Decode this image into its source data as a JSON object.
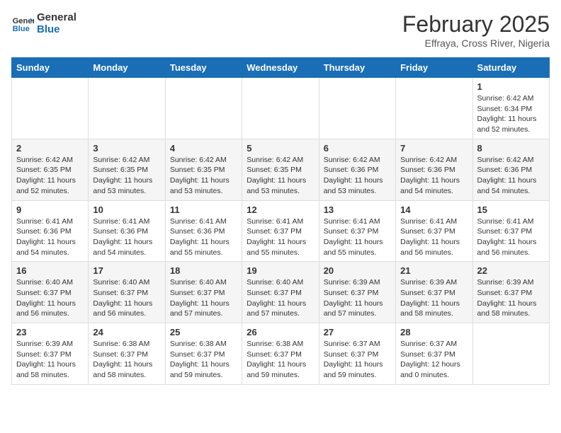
{
  "header": {
    "logo_line1": "General",
    "logo_line2": "Blue",
    "month_title": "February 2025",
    "location": "Effraya, Cross River, Nigeria"
  },
  "weekdays": [
    "Sunday",
    "Monday",
    "Tuesday",
    "Wednesday",
    "Thursday",
    "Friday",
    "Saturday"
  ],
  "weeks": [
    [
      {
        "day": "",
        "info": ""
      },
      {
        "day": "",
        "info": ""
      },
      {
        "day": "",
        "info": ""
      },
      {
        "day": "",
        "info": ""
      },
      {
        "day": "",
        "info": ""
      },
      {
        "day": "",
        "info": ""
      },
      {
        "day": "1",
        "info": "Sunrise: 6:42 AM\nSunset: 6:34 PM\nDaylight: 11 hours\nand 52 minutes."
      }
    ],
    [
      {
        "day": "2",
        "info": "Sunrise: 6:42 AM\nSunset: 6:35 PM\nDaylight: 11 hours\nand 52 minutes."
      },
      {
        "day": "3",
        "info": "Sunrise: 6:42 AM\nSunset: 6:35 PM\nDaylight: 11 hours\nand 53 minutes."
      },
      {
        "day": "4",
        "info": "Sunrise: 6:42 AM\nSunset: 6:35 PM\nDaylight: 11 hours\nand 53 minutes."
      },
      {
        "day": "5",
        "info": "Sunrise: 6:42 AM\nSunset: 6:35 PM\nDaylight: 11 hours\nand 53 minutes."
      },
      {
        "day": "6",
        "info": "Sunrise: 6:42 AM\nSunset: 6:36 PM\nDaylight: 11 hours\nand 53 minutes."
      },
      {
        "day": "7",
        "info": "Sunrise: 6:42 AM\nSunset: 6:36 PM\nDaylight: 11 hours\nand 54 minutes."
      },
      {
        "day": "8",
        "info": "Sunrise: 6:42 AM\nSunset: 6:36 PM\nDaylight: 11 hours\nand 54 minutes."
      }
    ],
    [
      {
        "day": "9",
        "info": "Sunrise: 6:41 AM\nSunset: 6:36 PM\nDaylight: 11 hours\nand 54 minutes."
      },
      {
        "day": "10",
        "info": "Sunrise: 6:41 AM\nSunset: 6:36 PM\nDaylight: 11 hours\nand 54 minutes."
      },
      {
        "day": "11",
        "info": "Sunrise: 6:41 AM\nSunset: 6:36 PM\nDaylight: 11 hours\nand 55 minutes."
      },
      {
        "day": "12",
        "info": "Sunrise: 6:41 AM\nSunset: 6:37 PM\nDaylight: 11 hours\nand 55 minutes."
      },
      {
        "day": "13",
        "info": "Sunrise: 6:41 AM\nSunset: 6:37 PM\nDaylight: 11 hours\nand 55 minutes."
      },
      {
        "day": "14",
        "info": "Sunrise: 6:41 AM\nSunset: 6:37 PM\nDaylight: 11 hours\nand 56 minutes."
      },
      {
        "day": "15",
        "info": "Sunrise: 6:41 AM\nSunset: 6:37 PM\nDaylight: 11 hours\nand 56 minutes."
      }
    ],
    [
      {
        "day": "16",
        "info": "Sunrise: 6:40 AM\nSunset: 6:37 PM\nDaylight: 11 hours\nand 56 minutes."
      },
      {
        "day": "17",
        "info": "Sunrise: 6:40 AM\nSunset: 6:37 PM\nDaylight: 11 hours\nand 56 minutes."
      },
      {
        "day": "18",
        "info": "Sunrise: 6:40 AM\nSunset: 6:37 PM\nDaylight: 11 hours\nand 57 minutes."
      },
      {
        "day": "19",
        "info": "Sunrise: 6:40 AM\nSunset: 6:37 PM\nDaylight: 11 hours\nand 57 minutes."
      },
      {
        "day": "20",
        "info": "Sunrise: 6:39 AM\nSunset: 6:37 PM\nDaylight: 11 hours\nand 57 minutes."
      },
      {
        "day": "21",
        "info": "Sunrise: 6:39 AM\nSunset: 6:37 PM\nDaylight: 11 hours\nand 58 minutes."
      },
      {
        "day": "22",
        "info": "Sunrise: 6:39 AM\nSunset: 6:37 PM\nDaylight: 11 hours\nand 58 minutes."
      }
    ],
    [
      {
        "day": "23",
        "info": "Sunrise: 6:39 AM\nSunset: 6:37 PM\nDaylight: 11 hours\nand 58 minutes."
      },
      {
        "day": "24",
        "info": "Sunrise: 6:38 AM\nSunset: 6:37 PM\nDaylight: 11 hours\nand 58 minutes."
      },
      {
        "day": "25",
        "info": "Sunrise: 6:38 AM\nSunset: 6:37 PM\nDaylight: 11 hours\nand 59 minutes."
      },
      {
        "day": "26",
        "info": "Sunrise: 6:38 AM\nSunset: 6:37 PM\nDaylight: 11 hours\nand 59 minutes."
      },
      {
        "day": "27",
        "info": "Sunrise: 6:37 AM\nSunset: 6:37 PM\nDaylight: 11 hours\nand 59 minutes."
      },
      {
        "day": "28",
        "info": "Sunrise: 6:37 AM\nSunset: 6:37 PM\nDaylight: 12 hours\nand 0 minutes."
      },
      {
        "day": "",
        "info": ""
      }
    ]
  ]
}
